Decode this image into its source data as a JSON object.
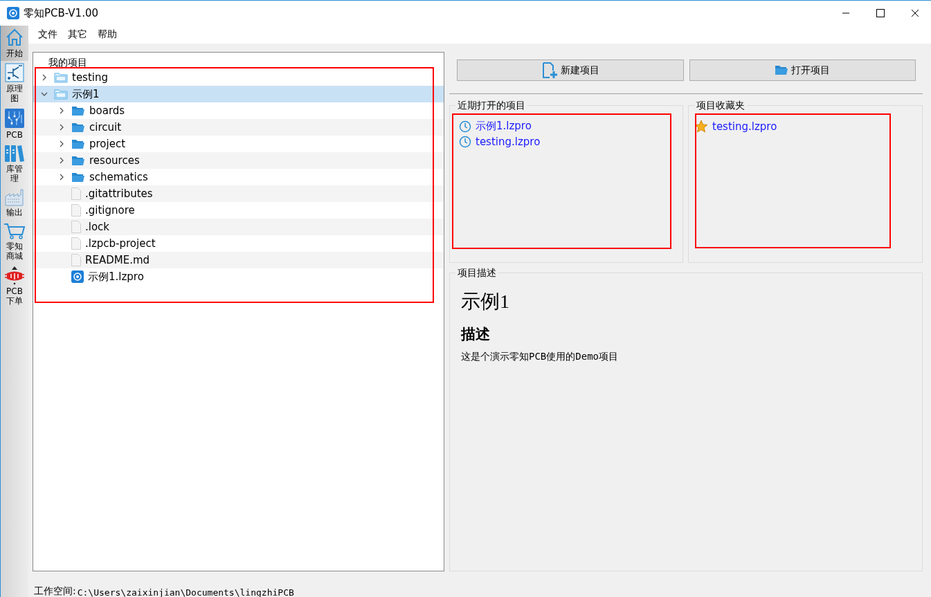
{
  "window": {
    "title": "零知PCB-V1.00"
  },
  "menu": [
    "文件",
    "其它",
    "帮助"
  ],
  "sidebar": {
    "items": [
      {
        "kind": "home",
        "label": "开始",
        "selected": true
      },
      {
        "kind": "schematic",
        "label": "原理图",
        "selected": false
      },
      {
        "kind": "pcb",
        "label": "PCB",
        "selected": false
      },
      {
        "kind": "library",
        "label": "库管理",
        "selected": false
      },
      {
        "kind": "output",
        "label": "输出",
        "selected": false
      },
      {
        "kind": "cart",
        "label": "零知商城",
        "selected": false
      },
      {
        "kind": "order",
        "label": "PCB下单",
        "selected": false
      }
    ]
  },
  "project_tree": {
    "title": "我的项目",
    "items": [
      {
        "kind": "project_folder",
        "name": "testing",
        "expanded": false,
        "selected": false
      },
      {
        "kind": "project_folder",
        "name": "示例1",
        "expanded": true,
        "selected": true,
        "children": [
          {
            "kind": "folder",
            "name": "boards",
            "expanded": false,
            "selected": false
          },
          {
            "kind": "folder",
            "name": "circuit",
            "expanded": false,
            "selected": false
          },
          {
            "kind": "folder",
            "name": "project",
            "expanded": false,
            "selected": false
          },
          {
            "kind": "folder",
            "name": "resources",
            "expanded": false,
            "selected": false
          },
          {
            "kind": "folder",
            "name": "schematics",
            "expanded": false,
            "selected": false
          },
          {
            "kind": "file",
            "name": ".gitattributes",
            "selected": false
          },
          {
            "kind": "file",
            "name": ".gitignore",
            "selected": false
          },
          {
            "kind": "file",
            "name": ".lock",
            "selected": false
          },
          {
            "kind": "file",
            "name": ".lzpcb-project",
            "selected": false
          },
          {
            "kind": "file",
            "name": "README.md",
            "selected": false
          },
          {
            "kind": "project_file",
            "name": "示例1.lzpro",
            "selected": false
          }
        ]
      }
    ]
  },
  "buttons": [
    {
      "kind": "new",
      "label": "新建项目"
    },
    {
      "kind": "open",
      "label": "打开项目"
    }
  ],
  "recent": {
    "title": "近期打开的项目",
    "items": [
      "示例1.lzpro",
      "testing.lzpro"
    ]
  },
  "favorites": {
    "title": "项目收藏夹",
    "items": [
      "testing.lzpro"
    ]
  },
  "description": {
    "title": "项目描述",
    "heading": "示例1",
    "subheading": "描述",
    "text": "这是个演示零知PCB使用的Demo项目"
  },
  "status_bar": {
    "label": "工作空间:",
    "path": "C:\\Users\\zaixinjian\\Documents\\lingzhiPCB"
  }
}
